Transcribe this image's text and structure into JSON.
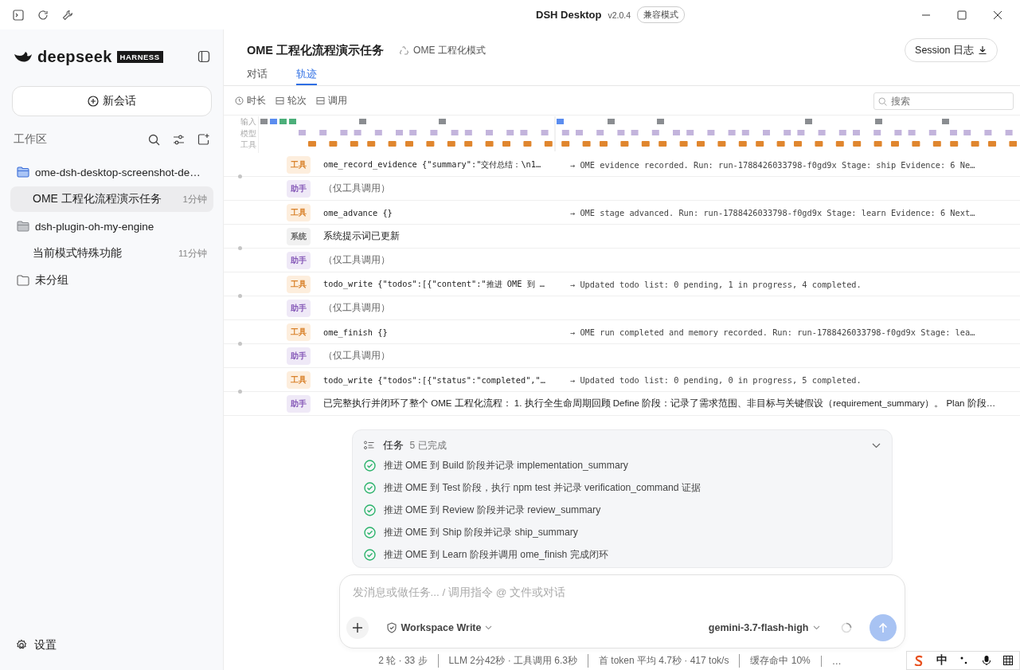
{
  "window": {
    "title": "DSH Desktop",
    "version": "v2.0.4",
    "mode_badge": "兼容模式"
  },
  "sidebar": {
    "brand": "deepseek",
    "brand_badge": "HARNESS",
    "new_chat": "新会话",
    "section_title": "工作区",
    "groups": [
      {
        "name": "ome-dsh-desktop-screenshot-de…",
        "kind": "project",
        "active": true,
        "sessions": [
          {
            "title": "OME 工程化流程演示任务",
            "time": "1分钟",
            "selected": true
          }
        ]
      },
      {
        "name": "dsh-plugin-oh-my-engine",
        "kind": "project",
        "active": false,
        "sessions": [
          {
            "title": "当前模式特殊功能",
            "time": "11分钟",
            "selected": false
          }
        ]
      },
      {
        "name": "未分组",
        "kind": "ungrouped"
      }
    ],
    "settings": "设置"
  },
  "header": {
    "title": "OME 工程化流程演示任务",
    "mode": "OME 工程化模式",
    "session_log_button": "Session 日志"
  },
  "tabs": [
    {
      "label": "对话",
      "selected": false
    },
    {
      "label": "轨迹",
      "selected": true
    }
  ],
  "filters": [
    {
      "label": "时长",
      "kind": "clock"
    },
    {
      "label": "轮次",
      "kind": "split"
    },
    {
      "label": "调用",
      "kind": "split"
    }
  ],
  "search": {
    "placeholder": "搜索"
  },
  "timeline": {
    "lanes": [
      "输入",
      "模型",
      "工具"
    ]
  },
  "trace_rows": [
    {
      "kind": "tool",
      "badge": "工具",
      "text": "ome_record_evidence {\"summary\":\"交付总结：\\n1…",
      "result": "→ OME evidence recorded. Run: run-1788426033798-f0gd9x Stage: ship Evidence: 6 Ne…",
      "turn_end": true
    },
    {
      "kind": "assistant",
      "badge": "助手",
      "text": "（仅工具调用）",
      "turn_end": false
    },
    {
      "kind": "tool",
      "badge": "工具",
      "text": "ome_advance {}",
      "result": "→ OME stage advanced. Run: run-1788426033798-f0gd9x Stage: learn Evidence: 6 Next…",
      "turn_end": false
    },
    {
      "kind": "system",
      "badge": "系统",
      "text": "系统提示词已更新",
      "turn_end": true
    },
    {
      "kind": "assistant",
      "badge": "助手",
      "text": "（仅工具调用）",
      "turn_end": false
    },
    {
      "kind": "tool",
      "badge": "工具",
      "text": "todo_write {\"todos\":[{\"content\":\"推进 OME 到 …",
      "result": "→ Updated todo list: 0 pending, 1 in progress, 4 completed.",
      "turn_end": true
    },
    {
      "kind": "assistant",
      "badge": "助手",
      "text": "（仅工具调用）",
      "turn_end": false
    },
    {
      "kind": "tool",
      "badge": "工具",
      "text": "ome_finish {}",
      "result": "→ OME run completed and memory recorded. Run: run-1788426033798-f0gd9x Stage: lea…",
      "turn_end": true
    },
    {
      "kind": "assistant",
      "badge": "助手",
      "text": "（仅工具调用）",
      "turn_end": false
    },
    {
      "kind": "tool",
      "badge": "工具",
      "text": "todo_write {\"todos\":[{\"status\":\"completed\",\"…",
      "result": "→ Updated todo list: 0 pending, 0 in progress, 5 completed.",
      "turn_end": true
    },
    {
      "kind": "assistant",
      "badge": "助手",
      "text": "已完整执行并闭环了整个 OME 工程化流程： 1. 执行全生命周期回顾 Define 阶段：记录了需求范围、非目标与关键假设（requirement_summary）。 Plan 阶段…",
      "turn_end": false
    }
  ],
  "tasks": {
    "title": "任务",
    "count": "5 已完成",
    "items": [
      {
        "text": "推进 OME 到 Build 阶段并记录 implementation_summary",
        "done": true
      },
      {
        "text": "推进 OME 到 Test 阶段，执行 npm test 并记录 verification_command 证据",
        "done": true
      },
      {
        "text": "推进 OME 到 Review 阶段并记录 review_summary",
        "done": true
      },
      {
        "text": "推进 OME 到 Ship 阶段并记录 ship_summary",
        "done": true
      },
      {
        "text": "推进 OME 到 Learn 阶段并调用 ome_finish 完成闭环",
        "done": true
      }
    ]
  },
  "composer": {
    "placeholder": "发消息或做任务... / 调用指令 @ 文件或对话",
    "permission": "Workspace Write",
    "model": "gemini-3.7-flash-high"
  },
  "status_bar": [
    "2 轮 · 33 步",
    "LLM 2分42秒 · 工具调用 6.3秒",
    "首 token 平均 4.7秒 · 417 tok/s",
    "缓存命中 10%",
    "…"
  ],
  "ime": {
    "language": "中"
  }
}
